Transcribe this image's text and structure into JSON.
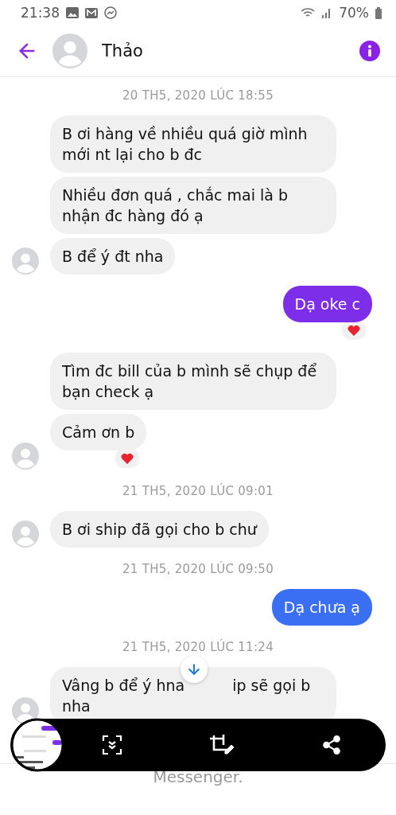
{
  "status_bar": {
    "time": "21:38",
    "battery": "70%"
  },
  "header": {
    "name": "Thảo"
  },
  "thread": [
    {
      "kind": "date",
      "text": "20 TH5, 2020 LÚC 18:55"
    },
    {
      "kind": "incoming",
      "messages": [
        {
          "text": "B ơi hàng về nhiều quá giờ mình mới nt lại cho b đc",
          "reaction": false
        },
        {
          "text": "Nhiều đơn quá , chắc mai là b nhận đc hàng đó ạ",
          "reaction": false
        },
        {
          "text": "B để ý đt nha",
          "reaction": false
        }
      ]
    },
    {
      "kind": "outgoing",
      "messages": [
        {
          "text": "Dạ oke c",
          "color": "#7d2ee8",
          "reaction": true
        }
      ]
    },
    {
      "kind": "incoming",
      "messages": [
        {
          "text": "Tìm đc bill của b mình sẽ chụp để bạn check ạ",
          "reaction": false
        },
        {
          "text": "Cảm ơn b",
          "reaction": true
        }
      ]
    },
    {
      "kind": "date",
      "text": "21 TH5, 2020 LÚC 09:01"
    },
    {
      "kind": "incoming",
      "messages": [
        {
          "text": "B ơi ship đã gọi cho b chư",
          "reaction": false
        }
      ]
    },
    {
      "kind": "date",
      "text": "21 TH5, 2020 LÚC 09:50"
    },
    {
      "kind": "outgoing",
      "messages": [
        {
          "text": "Dạ chưa ạ",
          "color": "#3a6ef3",
          "reaction": false
        }
      ]
    },
    {
      "kind": "date",
      "text": "21 TH5, 2020 LÚC 11:24"
    },
    {
      "kind": "incoming",
      "messages": [
        {
          "text_parts": [
            "Vâng b để ý hna",
            "ip sẽ gọi b nha"
          ],
          "reaction": false
        }
      ]
    }
  ],
  "footer": {
    "text": "Messenger."
  }
}
